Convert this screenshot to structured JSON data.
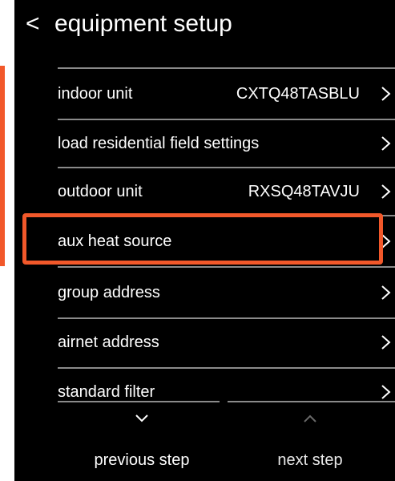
{
  "header": {
    "back_glyph": "<",
    "title": "equipment setup"
  },
  "rows": [
    {
      "label": "indoor unit",
      "value": "CXTQ48TASBLU",
      "icon": "chevron-right-icon"
    },
    {
      "label": "load residential field settings",
      "value": "",
      "icon": "chevron-right-icon"
    },
    {
      "label": "outdoor unit",
      "value": "RXSQ48TAVJU",
      "icon": "chevron-right-icon"
    },
    {
      "label": "aux heat source",
      "value": "",
      "icon": "chevron-right-icon",
      "highlighted": true
    },
    {
      "label": "group address",
      "value": "",
      "icon": "chevron-right-icon"
    },
    {
      "label": "airnet address",
      "value": "",
      "icon": "chevron-right-icon"
    },
    {
      "label": "standard filter",
      "value": "",
      "icon": "chevron-right-icon"
    }
  ],
  "footer": {
    "previous_label": "previous step",
    "previous_icon": "chevron-down-icon",
    "next_label": "next step",
    "next_icon": "chevron-up-icon"
  },
  "colors": {
    "background": "#000000",
    "text": "#ffffff",
    "divider": "#8a8a8a",
    "highlight": "#f2582a",
    "disabled_arrow": "#6a6a6a"
  }
}
